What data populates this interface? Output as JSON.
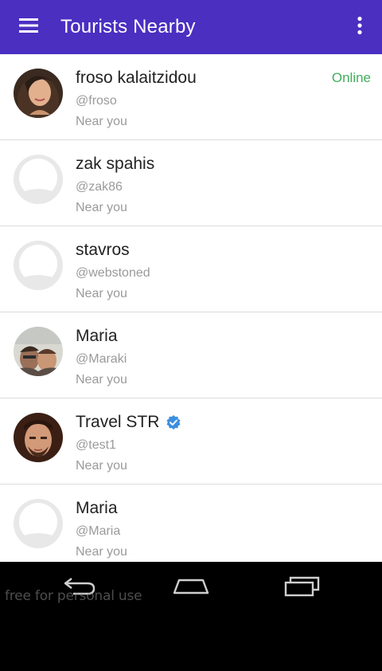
{
  "app": {
    "title": "Tourists Nearby",
    "accent_color": "#4a2fc1",
    "menu_icon": "hamburger-menu-icon",
    "overflow_icon": "more-vert-icon"
  },
  "users": [
    {
      "name": "froso kalaitzidou",
      "handle": "@froso",
      "distance": "Near you",
      "status": "Online",
      "avatar": "photo",
      "verified": false
    },
    {
      "name": "zak spahis",
      "handle": "@zak86",
      "distance": "Near you",
      "status": "",
      "avatar": "placeholder",
      "verified": false
    },
    {
      "name": "stavros",
      "handle": "@webstoned",
      "distance": "Near you",
      "status": "",
      "avatar": "placeholder",
      "verified": false
    },
    {
      "name": "Maria",
      "handle": "@Maraki",
      "distance": "Near you",
      "status": "",
      "avatar": "photo",
      "verified": false
    },
    {
      "name": "Travel STR",
      "handle": "@test1",
      "distance": "Near you",
      "status": "",
      "avatar": "photo",
      "verified": true
    },
    {
      "name": "Maria",
      "handle": "@Maria",
      "distance": "Near you",
      "status": "",
      "avatar": "placeholder",
      "verified": false
    }
  ],
  "status_color": "#3fae5c",
  "verified_color": "#3b8fe0",
  "navigation": {
    "back_icon": "back-icon",
    "home_icon": "home-icon",
    "recents_icon": "recent-apps-icon"
  },
  "watermark": "free for personal use"
}
